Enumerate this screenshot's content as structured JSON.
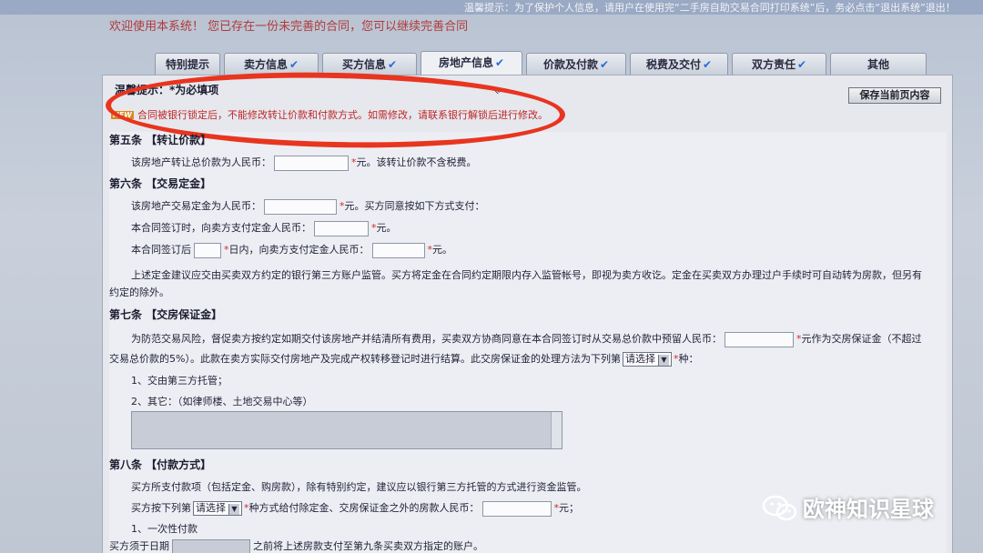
{
  "top_notice": "温馨提示：为了保护个人信息，请用户在使用完“二手房自助交易合同打印系统”后，务必点击“退出系统”退出！",
  "welcome": "欢迎使用本系统！ 您已存在一份未完善的合同，您可以继续完善合同",
  "tabs": [
    {
      "label": "特别提示",
      "checked": false
    },
    {
      "label": "卖方信息",
      "checked": true
    },
    {
      "label": "买方信息",
      "checked": true
    },
    {
      "label": "房地产信息",
      "checked": true
    },
    {
      "label": "价款及付款",
      "checked": true
    },
    {
      "label": "税费及交付",
      "checked": true
    },
    {
      "label": "双方责任",
      "checked": true
    },
    {
      "label": "其他",
      "checked": false
    }
  ],
  "warm_tip": "温馨提示：*为必填项",
  "save_button": "保存当前页内容",
  "notice": {
    "badge": "NEW",
    "text": "合同被银行锁定后，不能修改转让价款和付款方式。如需修改，请联系银行解锁后进行修改。"
  },
  "article5": {
    "title": "第五条 【转让价款】",
    "line1_a": "该房地产转让总价款为人民币：",
    "line1_b": "元。该转让价款不含税费。"
  },
  "article6": {
    "title": "第六条 【交易定金】",
    "line1_a": "该房地产交易定金为人民币：",
    "line1_b": "元。买方同意按如下方式支付：",
    "line2_a": "本合同签订时，向卖方支付定金人民币：",
    "line2_b": "元。",
    "line3_a": "本合同签订后",
    "line3_b": "日内，向卖方支付定金人民币：",
    "line3_c": "元。",
    "para1": "上述定金建议应交由买卖双方约定的银行第三方账户监管。买方将定金在合同约定期限内存入监管帐号，即视为卖方收讫。定金在买卖双方办理过户手续时可自动转为房款，但另有",
    "para2": "约定的除外。"
  },
  "article7": {
    "title": "第七条 【交房保证金】",
    "para1_a": "为防范交易风险，督促卖方按约定如期交付该房地产并结清所有费用，买卖双方协商同意在本合同签订时从交易总价款中预留人民币：",
    "para1_b": "元作为交房保证金（不超过",
    "para2_a": "交易总价款的5%）。此款在卖方实际交付房地产及完成产权转移登记时进行结算。此交房保证金的处理方法为下列第",
    "para2_b": "种：",
    "select": "请选择",
    "opt1": "1、交由第三方托管；",
    "opt2": "2、其它：（如律师楼、土地交易中心等）"
  },
  "article8": {
    "title": "第八条 【付款方式】",
    "para1": "买方所支付款项（包括定金、购房款），除有特别约定，建议应以银行第三方托管的方式进行资金监管。",
    "line2_a": "买方按下列第",
    "select": "请选择",
    "line2_b": "种方式给付除定金、交房保证金之外的房款人民币：",
    "line2_c": "元；",
    "opt1": "1、一次性付款",
    "line4_a": "买方须于日期",
    "line4_b": "之前将上述房款支付至第九条买卖双方指定的账户。"
  },
  "watermark": "欧神知识星球",
  "colors": {
    "accent": "#bf2626",
    "circle": "#e8351f",
    "check": "#2a6ad6"
  }
}
